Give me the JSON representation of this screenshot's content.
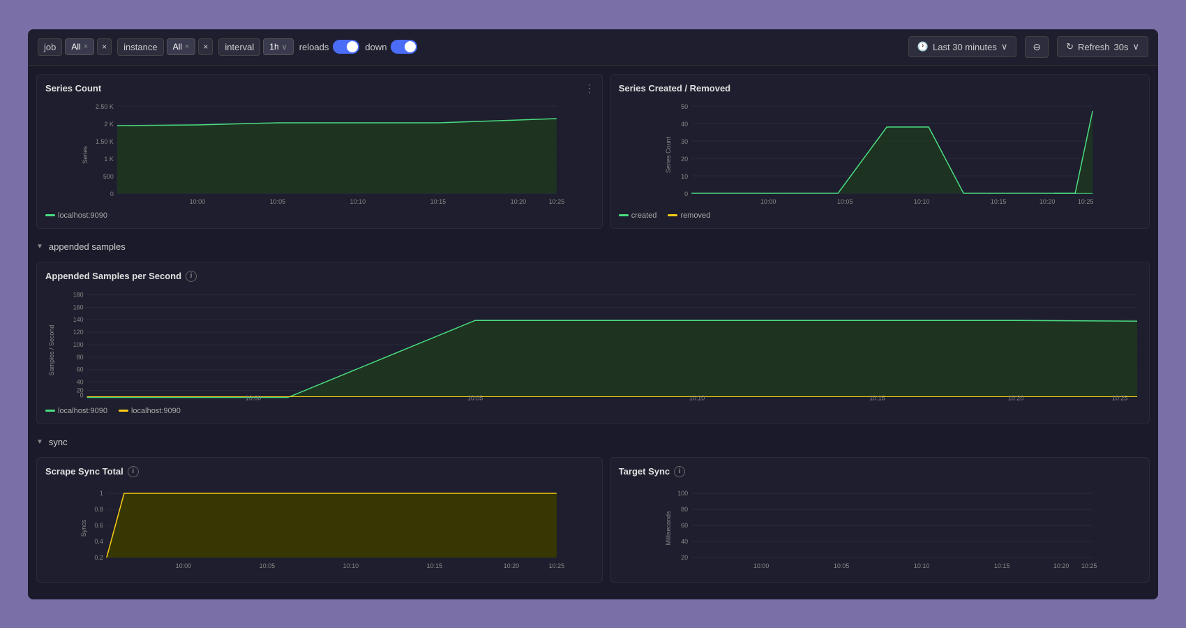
{
  "toolbar": {
    "filters": [
      {
        "label": "job",
        "value": "All",
        "close": "×",
        "dropdown": "×"
      },
      {
        "label": "instance",
        "value": "All",
        "close": "×",
        "dropdown": "×"
      }
    ],
    "interval_label": "interval",
    "interval_value": "1h",
    "reloads_label": "reloads",
    "down_label": "down",
    "time_label": "Last 30 minutes",
    "refresh_label": "Refresh",
    "refresh_interval": "30s"
  },
  "sections": {
    "appended_samples": "appended samples",
    "sync": "sync"
  },
  "charts": {
    "series_count": {
      "title": "Series Count",
      "y_axis_label": "Series",
      "legend": [
        {
          "color": "#4ade80",
          "label": "localhost:9090"
        }
      ],
      "x_ticks": [
        "10:00",
        "10:05",
        "10:10",
        "10:15",
        "10:20",
        "10:25"
      ],
      "y_ticks": [
        "0",
        "500",
        "1 K",
        "1.50 K",
        "2 K",
        "2.50 K"
      ]
    },
    "series_created_removed": {
      "title": "Series Created / Removed",
      "y_axis_label": "Series Count",
      "legend": [
        {
          "color": "#4ade80",
          "label": "created"
        },
        {
          "color": "#facc15",
          "label": "removed"
        }
      ],
      "x_ticks": [
        "10:00",
        "10:05",
        "10:10",
        "10:15",
        "10:20",
        "10:25"
      ],
      "y_ticks": [
        "0",
        "10",
        "20",
        "30",
        "40",
        "50"
      ]
    },
    "appended_samples": {
      "title": "Appended Samples per Second",
      "y_axis_label": "Samples / Second",
      "legend": [
        {
          "color": "#4ade80",
          "label": "localhost:9090"
        },
        {
          "color": "#facc15",
          "label": "localhost:9090"
        }
      ],
      "x_ticks": [
        "10:00",
        "10:05",
        "10:10",
        "10:15",
        "10:20",
        "10:25"
      ],
      "y_ticks": [
        "0",
        "20",
        "40",
        "60",
        "80",
        "100",
        "120",
        "140",
        "160",
        "180"
      ]
    },
    "scrape_sync_total": {
      "title": "Scrape Sync Total",
      "y_axis_label": "Syncs",
      "x_ticks": [
        "10:00",
        "10:05",
        "10:10",
        "10:15",
        "10:20",
        "10:25"
      ],
      "y_ticks": [
        "0.2",
        "0.4",
        "0.6",
        "0.8",
        "1"
      ]
    },
    "target_sync": {
      "title": "Target Sync",
      "y_axis_label": "Milliseconds",
      "x_ticks": [
        "10:00",
        "10:05",
        "10:10",
        "10:15",
        "10:20",
        "10:25"
      ],
      "y_ticks": [
        "20",
        "40",
        "60",
        "80",
        "100"
      ]
    }
  }
}
